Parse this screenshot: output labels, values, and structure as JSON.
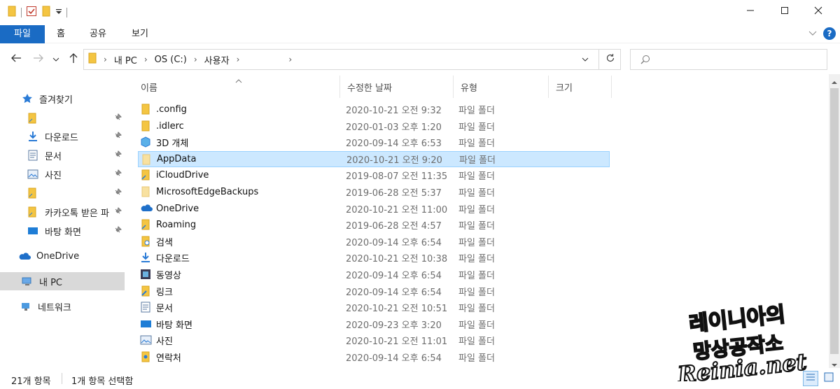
{
  "titlebar": {
    "quick_access_icons": [
      "folder-icon",
      "properties-check-icon",
      "new-folder-icon",
      "customize-dropdown-icon"
    ],
    "window_buttons": [
      "minimize-icon",
      "maximize-icon",
      "close-icon"
    ]
  },
  "ribbon": {
    "tabs": [
      "파일",
      "홈",
      "공유",
      "보기"
    ],
    "active_tab": "파일",
    "active_color": "#1a6bc4"
  },
  "address_bar": {
    "crumbs": [
      "내 PC",
      "OS (C:)",
      "사용자",
      ""
    ],
    "search_placeholder": ""
  },
  "nav": {
    "quick_access_label": "즐겨찾기",
    "quick_items": [
      {
        "label": "",
        "icon": "folder-icon"
      },
      {
        "label": "다운로드",
        "icon": "download-icon"
      },
      {
        "label": "문서",
        "icon": "document-icon"
      },
      {
        "label": "사진",
        "icon": "picture-icon"
      },
      {
        "label": "",
        "icon": "folder-icon"
      },
      {
        "label": "카카오톡 받은 파",
        "icon": "folder-shortcut-icon"
      },
      {
        "label": "바탕 화면",
        "icon": "desktop-icon"
      }
    ],
    "onedrive": "OneDrive",
    "this_pc": "내 PC",
    "network": "네트워크"
  },
  "columns": {
    "name": "이름",
    "date": "수정한 날짜",
    "type": "유형",
    "size": "크기"
  },
  "files": [
    {
      "name": ".config",
      "date": "2020-10-21 오전 9:32",
      "type": "파일 폴더",
      "icon": "folder-icon"
    },
    {
      "name": ".idlerc",
      "date": "2020-01-03 오후 1:20",
      "type": "파일 폴더",
      "icon": "folder-icon"
    },
    {
      "name": "3D 개체",
      "date": "2020-09-14 오후 6:53",
      "type": "파일 폴더",
      "icon": "3d-objects-icon"
    },
    {
      "name": "AppData",
      "date": "2020-10-21 오전 9:20",
      "type": "파일 폴더",
      "icon": "folder-hidden-icon"
    },
    {
      "name": "iCloudDrive",
      "date": "2019-08-07 오전 11:35",
      "type": "파일 폴더",
      "icon": "folder-shortcut-icon"
    },
    {
      "name": "MicrosoftEdgeBackups",
      "date": "2019-06-28 오전 5:37",
      "type": "파일 폴더",
      "icon": "folder-faded-icon"
    },
    {
      "name": "OneDrive",
      "date": "2020-10-21 오전 11:00",
      "type": "파일 폴더",
      "icon": "cloud-icon"
    },
    {
      "name": "Roaming",
      "date": "2019-06-28 오전 4:57",
      "type": "파일 폴더",
      "icon": "folder-shortcut-icon"
    },
    {
      "name": "검색",
      "date": "2020-09-14 오후 6:54",
      "type": "파일 폴더",
      "icon": "search-folder-icon"
    },
    {
      "name": "다운로드",
      "date": "2020-10-21 오전 10:38",
      "type": "파일 폴더",
      "icon": "download-icon"
    },
    {
      "name": "동영상",
      "date": "2020-09-14 오후 6:54",
      "type": "파일 폴더",
      "icon": "video-icon"
    },
    {
      "name": "링크",
      "date": "2020-09-14 오후 6:54",
      "type": "파일 폴더",
      "icon": "link-icon"
    },
    {
      "name": "문서",
      "date": "2020-10-21 오전 10:51",
      "type": "파일 폴더",
      "icon": "document-icon"
    },
    {
      "name": "바탕 화면",
      "date": "2020-09-23 오후 3:20",
      "type": "파일 폴더",
      "icon": "desktop-icon"
    },
    {
      "name": "사진",
      "date": "2020-10-21 오전 11:01",
      "type": "파일 폴더",
      "icon": "picture-icon"
    },
    {
      "name": "연락처",
      "date": "2020-09-14 오후 6:54",
      "type": "파일 폴더",
      "icon": "contacts-icon"
    }
  ],
  "selected_index": 3,
  "status": {
    "count": "21개 항목",
    "selected": "1개 항목 선택함"
  },
  "watermark": {
    "line1": "레이니아의",
    "line2": "망상공작소",
    "line3": "Reinia.net"
  }
}
